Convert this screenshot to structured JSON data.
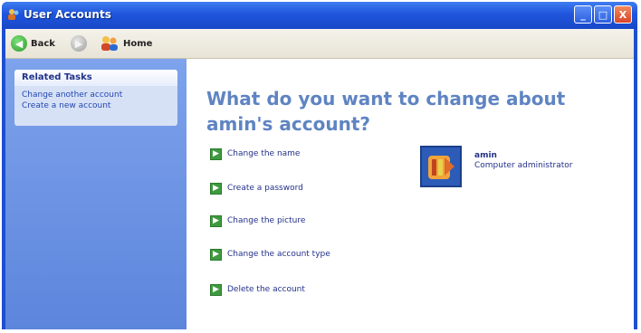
{
  "window": {
    "title": "User Accounts",
    "controls": {
      "minimize": "_",
      "maximize": "□",
      "close": "X"
    }
  },
  "toolbar": {
    "back_label": "Back",
    "back_icon": "back-arrow-icon",
    "forward_icon": "forward-arrow-icon",
    "home_label": "Home",
    "home_icon": "home-users-icon"
  },
  "sidebar": {
    "panel_title": "Related Tasks",
    "links": [
      "Change another account",
      "Create a new account"
    ]
  },
  "main": {
    "question": "What do you want to change about amin's account?",
    "tasks": [
      "Change the name",
      "Create a password",
      "Change the picture",
      "Change the account type",
      "Delete the account"
    ],
    "account": {
      "name": "amin",
      "type": "Computer administrator",
      "picture_icon": "guitar-picture-icon"
    }
  },
  "colors": {
    "titlebar": "#1f55dc",
    "sidebar": "#6b90e2",
    "task_arrow": "#3f9a3f",
    "heading": "#5f84c2"
  }
}
